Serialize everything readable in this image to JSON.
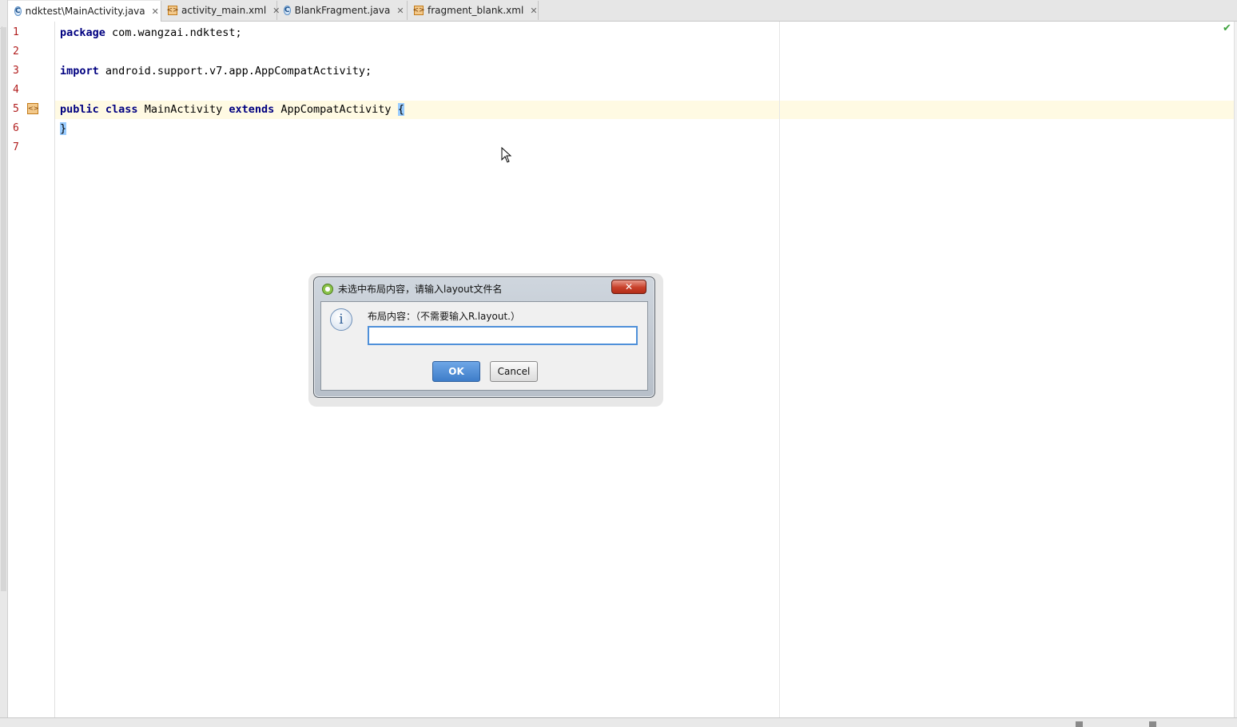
{
  "tabs": [
    {
      "label": "ndktest\\MainActivity.java",
      "icon": "java-class-icon",
      "active": true
    },
    {
      "label": "activity_main.xml",
      "icon": "xml-file-icon",
      "active": false
    },
    {
      "label": "BlankFragment.java",
      "icon": "java-class-icon",
      "active": false
    },
    {
      "label": "fragment_blank.xml",
      "icon": "xml-file-icon",
      "active": false
    }
  ],
  "editor": {
    "line_numbers": [
      "1",
      "2",
      "3",
      "4",
      "5",
      "6",
      "7"
    ],
    "lines": {
      "l1_kw": "package",
      "l1_rest": " com.wangzai.ndktest;",
      "l3_kw": "import",
      "l3_rest": " android.support.v7.app.AppCompatActivity;",
      "l5_kw1": "public",
      "l5_kw2": "class",
      "l5_name": " MainActivity ",
      "l5_kw3": "extends",
      "l5_super": " AppCompatActivity ",
      "l5_brace": "{",
      "l6_brace": "}"
    }
  },
  "dialog": {
    "title": "未选中布局内容，请输入layout文件名",
    "close_label": "✕",
    "prompt": "布局内容：（不需要输入R.layout.）",
    "input_value": "",
    "ok_label": "OK",
    "cancel_label": "Cancel"
  },
  "colors": {
    "keyword": "#000080",
    "line_number": "#b11d1d",
    "current_line": "#fffae3",
    "brace_match": "#99ccff",
    "ok_button": "#3e7dc9"
  }
}
